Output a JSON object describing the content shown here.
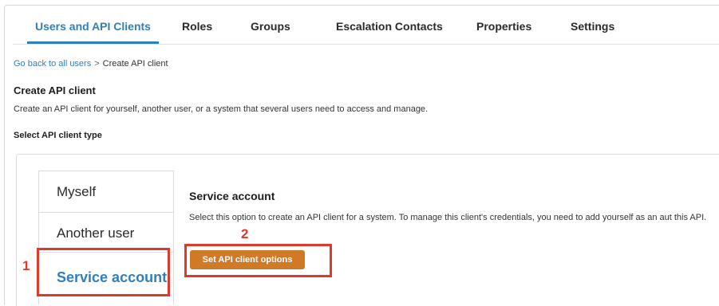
{
  "tabs": [
    {
      "label": "Users and API Clients",
      "active": true
    },
    {
      "label": "Roles",
      "active": false
    },
    {
      "label": "Groups",
      "active": false
    },
    {
      "label": "Escalation Contacts",
      "active": false
    },
    {
      "label": "Properties",
      "active": false
    },
    {
      "label": "Settings",
      "active": false
    }
  ],
  "breadcrumb": {
    "back_link": "Go back to all users",
    "separator": ">",
    "current": "Create API client"
  },
  "page": {
    "title": "Create API client",
    "description": "Create an API client for yourself, another user, or a system that several users need to access and manage."
  },
  "client_type": {
    "section_label": "Select API client type",
    "options": [
      {
        "label": "Myself",
        "selected": false
      },
      {
        "label": "Another user",
        "selected": false
      },
      {
        "label": "Service account",
        "selected": true
      }
    ]
  },
  "detail": {
    "title": "Service account",
    "description": "Select this option to create an API client for a system. To manage this client's credentials, you need to add yourself as an aut this API.",
    "button_label": "Set API client options"
  },
  "annotations": {
    "marker_1": "1",
    "marker_2": "2",
    "highlight_color": "#e0392b"
  },
  "colors": {
    "accent": "#2f7fbd",
    "primary_button": "#d07a28"
  }
}
